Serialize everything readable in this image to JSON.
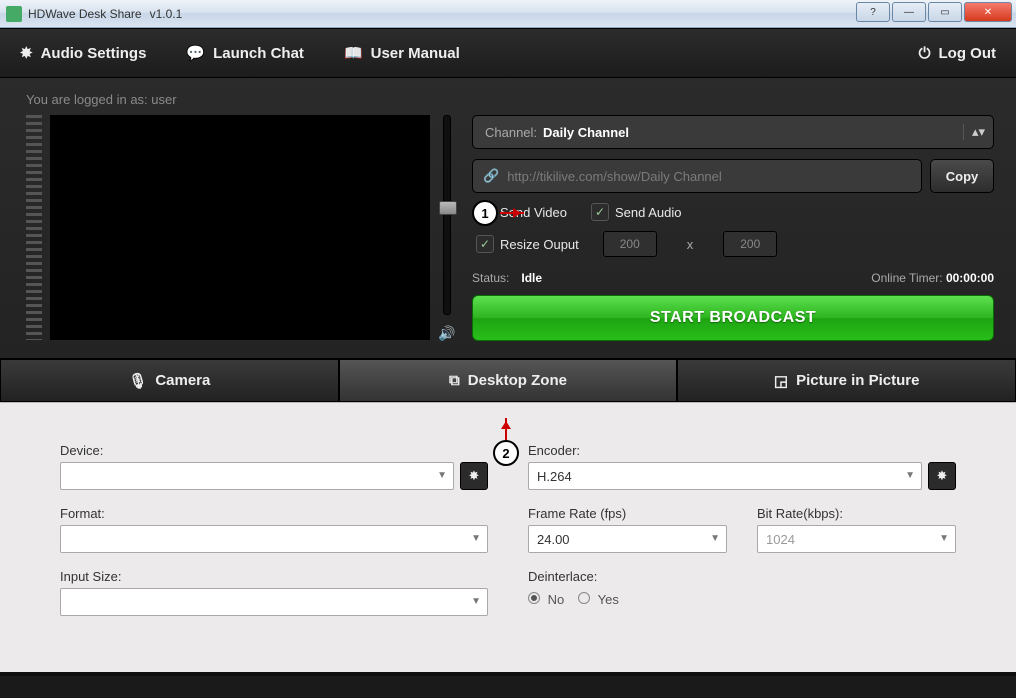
{
  "window": {
    "title": "HDWave Desk Share",
    "version": "v1.0.1"
  },
  "toolbar": {
    "audio_settings": "Audio Settings",
    "launch_chat": "Launch Chat",
    "user_manual": "User Manual",
    "log_out": "Log Out"
  },
  "login": {
    "prefix": "You are logged in as:",
    "user": "user"
  },
  "channel": {
    "label": "Channel:",
    "value": "Daily Channel"
  },
  "url": {
    "value": "http://tikilive.com/show/Daily Channel",
    "copy": "Copy"
  },
  "checks": {
    "send_video": "Send Video",
    "send_audio": "Send Audio",
    "resize_output": "Resize Ouput",
    "w": "200",
    "h": "200"
  },
  "status": {
    "label": "Status:",
    "value": "Idle",
    "timer_label": "Online Timer:",
    "timer_value": "00:00:00"
  },
  "broadcast_btn": "START BROADCAST",
  "tabs": {
    "camera": "Camera",
    "desktop_zone": "Desktop Zone",
    "pip": "Picture in Picture"
  },
  "settings": {
    "device_label": "Device:",
    "device_value": "",
    "format_label": "Format:",
    "format_value": "",
    "input_size_label": "Input Size:",
    "input_size_value": "",
    "encoder_label": "Encoder:",
    "encoder_value": "H.264",
    "fps_label": "Frame Rate (fps)",
    "fps_value": "24.00",
    "bitrate_label": "Bit Rate(kbps):",
    "bitrate_value": "1024",
    "deinterlace_label": "Deinterlace:",
    "no": "No",
    "yes": "Yes"
  },
  "callouts": {
    "one": "1",
    "two": "2"
  }
}
